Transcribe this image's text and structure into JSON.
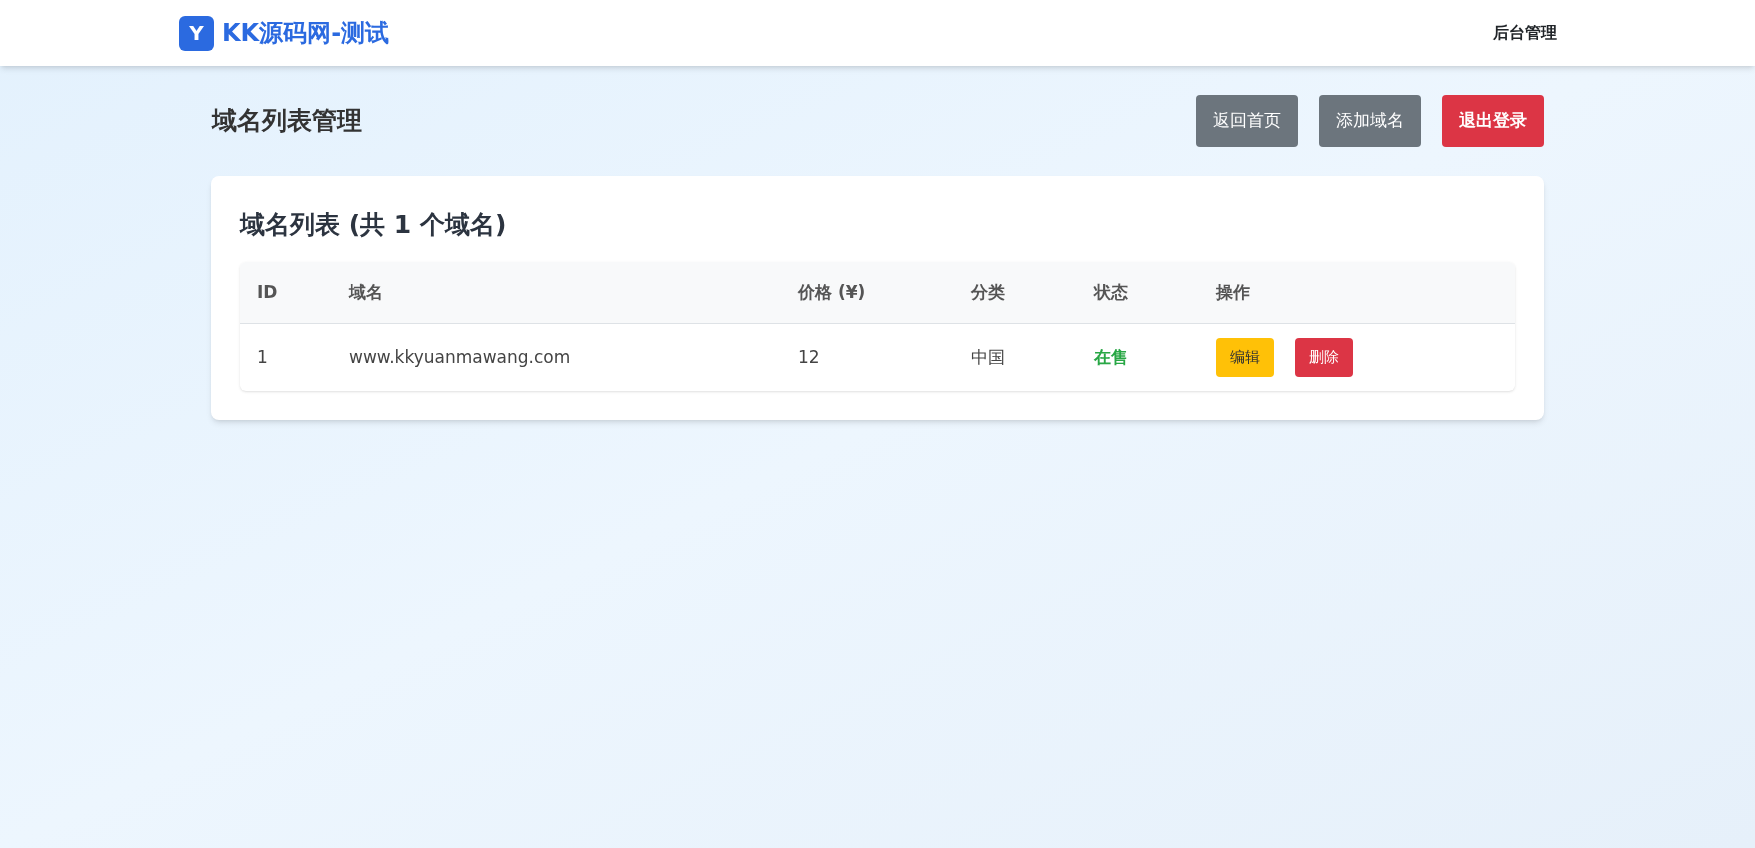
{
  "navbar": {
    "logo_letter": "Y",
    "brand": "KK源码网-测试",
    "link": "后台管理"
  },
  "page": {
    "title": "域名列表管理",
    "buttons": [
      {
        "label": "返回首页",
        "kind": "secondary"
      },
      {
        "label": "添加域名",
        "kind": "secondary"
      },
      {
        "label": "退出登录",
        "kind": "danger"
      }
    ]
  },
  "card": {
    "title": "域名列表 (共 1 个域名)",
    "table": {
      "columns": [
        "ID",
        "域名",
        "价格 (¥)",
        "分类",
        "状态",
        "操作"
      ],
      "rows": [
        {
          "id": "1",
          "domain": "www.kkyuanmawang.com",
          "price": "12",
          "category": "中国",
          "status": {
            "text": "在售",
            "kind": "on_sale"
          },
          "actions": [
            {
              "label": "编辑",
              "kind": "warning"
            },
            {
              "label": "删除",
              "kind": "danger"
            }
          ]
        }
      ]
    }
  }
}
